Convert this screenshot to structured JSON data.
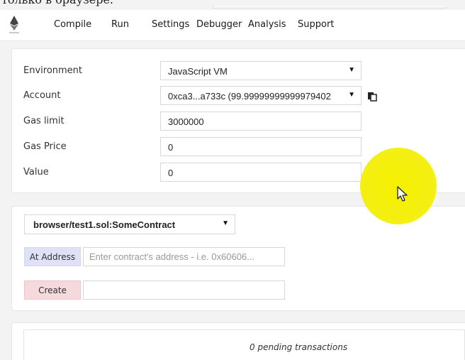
{
  "overlay": {
    "cutoff_caption": "только в браузере."
  },
  "nav": {
    "tabs": [
      {
        "label": "Compile",
        "active": false
      },
      {
        "label": "Run",
        "active": true
      },
      {
        "label": "Settings",
        "active": false
      },
      {
        "label": "Debugger",
        "active": false
      },
      {
        "label": "Analysis",
        "active": false
      },
      {
        "label": "Support",
        "active": false
      }
    ]
  },
  "settings": {
    "environment": {
      "label": "Environment",
      "value": "JavaScript VM"
    },
    "account": {
      "label": "Account",
      "value": "0xca3...a733c (99.99999999999979402"
    },
    "gas_limit": {
      "label": "Gas limit",
      "value": "3000000"
    },
    "gas_price": {
      "label": "Gas Price",
      "value": "0"
    },
    "value": {
      "label": "Value",
      "value": "0"
    }
  },
  "contract": {
    "selected": "browser/test1.sol:SomeContract",
    "at_address_label": "At Address",
    "address_placeholder": "Enter contract's address - i.e. 0x60606...",
    "create_label": "Create"
  },
  "pending": {
    "text": "0 pending transactions"
  },
  "colors": {
    "at_address_bg": "#dfe2f7",
    "create_bg": "#f6d9dc",
    "cursor_halo": "#f5f000"
  },
  "icons": {
    "logo": "ethereum-icon",
    "copy": "copy-icon",
    "cursor": "mouse-pointer-icon"
  }
}
